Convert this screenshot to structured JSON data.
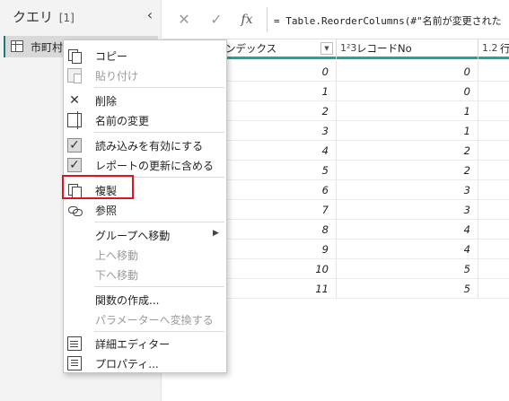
{
  "query_pane": {
    "title": "クエリ",
    "count": "[1]",
    "collapse_glyph": "‹",
    "items": [
      {
        "label": "市町村",
        "icon": "table-icon"
      }
    ]
  },
  "formula_bar": {
    "cancel_glyph": "✕",
    "commit_glyph": "✓",
    "fx_glyph": "fx",
    "formula": "= Table.ReorderColumns(#\"名前が変更された"
  },
  "grid": {
    "columns": [
      {
        "type": "",
        "label": "ンデックス"
      },
      {
        "type": "1²3",
        "label": "レコードNo"
      },
      {
        "type": "1.2",
        "label": "行"
      }
    ],
    "rows": [
      [
        "0",
        "0"
      ],
      [
        "1",
        "0"
      ],
      [
        "2",
        "1"
      ],
      [
        "3",
        "1"
      ],
      [
        "4",
        "2"
      ],
      [
        "5",
        "2"
      ],
      [
        "6",
        "3"
      ],
      [
        "7",
        "3"
      ],
      [
        "8",
        "4"
      ],
      [
        "9",
        "4"
      ],
      [
        "10",
        "5"
      ],
      [
        "11",
        "5"
      ]
    ]
  },
  "context_menu": {
    "items": [
      {
        "label": "コピー",
        "icon": "copy-icon",
        "enabled": true
      },
      {
        "label": "貼り付け",
        "icon": "paste-icon",
        "enabled": false
      },
      {
        "label": "削除",
        "icon": "delete-icon",
        "enabled": true
      },
      {
        "label": "名前の変更",
        "icon": "rename-icon",
        "enabled": true
      },
      {
        "label": "読み込みを有効にする",
        "icon": "checkbox-checked-icon",
        "enabled": true
      },
      {
        "label": "レポートの更新に含める",
        "icon": "checkbox-checked-icon",
        "enabled": true
      },
      {
        "label": "複製",
        "icon": "duplicate-icon",
        "enabled": true
      },
      {
        "label": "参照",
        "icon": "reference-icon",
        "enabled": true
      },
      {
        "label": "グループへ移動",
        "icon": "",
        "enabled": true,
        "submenu": "▶"
      },
      {
        "label": "上へ移動",
        "icon": "",
        "enabled": false
      },
      {
        "label": "下へ移動",
        "icon": "",
        "enabled": false
      },
      {
        "label": "関数の作成...",
        "icon": "",
        "enabled": true
      },
      {
        "label": "パラメーターへ変換する",
        "icon": "",
        "enabled": false
      },
      {
        "label": "詳細エディター",
        "icon": "advanced-editor-icon",
        "enabled": true
      },
      {
        "label": "プロパティ...",
        "icon": "properties-icon",
        "enabled": true
      }
    ],
    "highlight_color": "#e0141e"
  },
  "colors": {
    "accent": "#19a99a",
    "selected_query_border": "#1e7a7a"
  }
}
